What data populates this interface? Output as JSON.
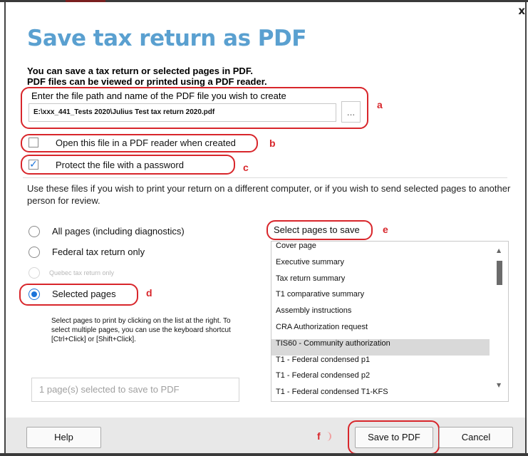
{
  "dialog": {
    "title": "Save tax return as PDF",
    "close_label": "x",
    "intro_line1": "You can save a tax return or selected pages in PDF.",
    "intro_line2": "PDF files can be viewed or printed using a PDF reader."
  },
  "file": {
    "label": "Enter the file path and name of the PDF file you wish to create",
    "path": "E:\\xxx_441_Tests 2020\\Julius Test tax return 2020.pdf",
    "browse_label": "..."
  },
  "options": {
    "open_reader": {
      "label": "Open this file in a PDF reader when created",
      "checked": false
    },
    "protect": {
      "label": "Protect the file with a password",
      "checked": true
    }
  },
  "info_text": "Use these files if you wish to print your return on a different computer, or if you wish to send selected pages to another person for review.",
  "radios": [
    {
      "label": "All pages (including diagnostics)",
      "selected": false,
      "enabled": true
    },
    {
      "label": "Federal tax return only",
      "selected": false,
      "enabled": true
    },
    {
      "label": "Quebec tax return only",
      "selected": false,
      "enabled": false
    },
    {
      "label": "Selected pages",
      "selected": true,
      "enabled": true
    }
  ],
  "hint": "Select pages to print by clicking on the list at the right. To select multiple pages, you can use the keyboard shortcut [Ctrl+Click] or [Shift+Click].",
  "selection_summary": "1 page(s) selected to save to PDF",
  "pages": {
    "label": "Select pages to save",
    "items": [
      "Cover page",
      "Executive summary",
      "Tax return summary",
      "T1 comparative summary",
      "Assembly instructions",
      "CRA Authorization request",
      "TIS60 - Community authorization",
      "T1 - Federal condensed p1",
      "T1 - Federal condensed p2",
      "T1 - Federal condensed T1-KFS"
    ],
    "selected_index": 6,
    "scroll_up": "▲",
    "scroll_down": "▼"
  },
  "annotations": {
    "a": "a",
    "b": "b",
    "c": "c",
    "d": "d",
    "e": "e",
    "f": "f"
  },
  "buttons": {
    "help": "Help",
    "save": "Save to PDF",
    "cancel": "Cancel"
  },
  "colors": {
    "title": "#5aa0d0",
    "annotation": "#d8262b",
    "accent": "#1a73d9"
  }
}
